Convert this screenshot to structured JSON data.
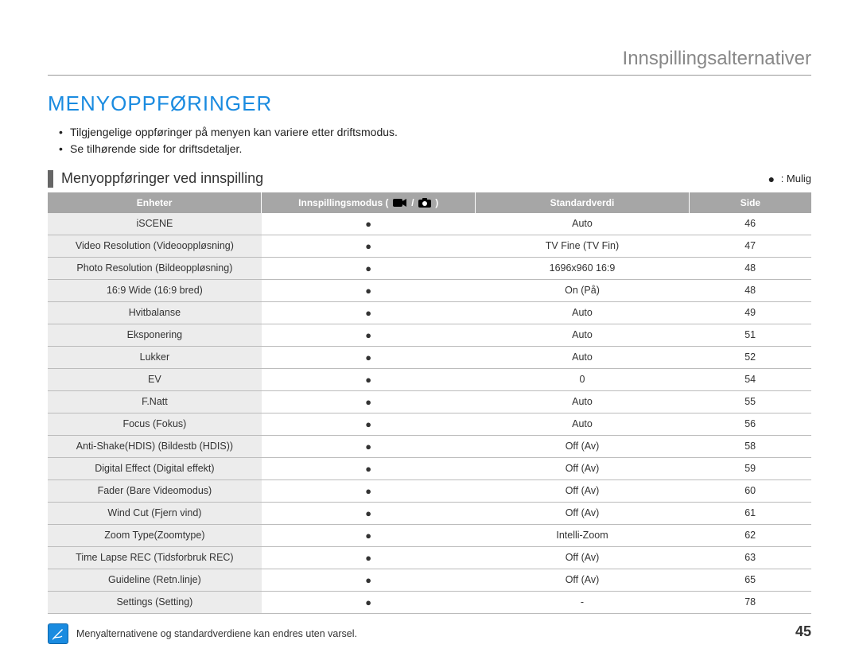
{
  "topTitle": "Innspillingsalternativer",
  "mainHeading": "MENYOPPFØRINGER",
  "bullets": [
    "Tilgjengelige oppføringer på menyen kan variere etter driftsmodus.",
    "Se tilhørende side for driftsdetaljer."
  ],
  "subHeading": "Menyoppføringer ved innspilling",
  "legend": {
    "symbol": "●",
    "label": ": Mulig"
  },
  "table": {
    "headers": {
      "units": "Enheter",
      "modePrefix": "Innspillingsmodus (",
      "modeSep": " / ",
      "modeSuffix": ")",
      "default": "Standardverdi",
      "page": "Side"
    },
    "rows": [
      {
        "name": "iSCENE",
        "mode": "●",
        "default": "Auto",
        "page": "46"
      },
      {
        "name": "Video Resolution (Videooppløsning)",
        "mode": "●",
        "default": "TV Fine (TV Fin)",
        "page": "47"
      },
      {
        "name": "Photo Resolution (Bildeoppløsning)",
        "mode": "●",
        "default": "1696x960 16:9",
        "page": "48"
      },
      {
        "name": "16:9 Wide (16:9 bred)",
        "mode": "●",
        "default": "On (På)",
        "page": "48"
      },
      {
        "name": "Hvitbalanse",
        "mode": "●",
        "default": "Auto",
        "page": "49"
      },
      {
        "name": "Eksponering",
        "mode": "●",
        "default": "Auto",
        "page": "51"
      },
      {
        "name": "Lukker",
        "mode": "●",
        "default": "Auto",
        "page": "52"
      },
      {
        "name": "EV",
        "mode": "●",
        "default": "0",
        "page": "54"
      },
      {
        "name": "F.Natt",
        "mode": "●",
        "default": "Auto",
        "page": "55"
      },
      {
        "name": "Focus (Fokus)",
        "mode": "●",
        "default": "Auto",
        "page": "56"
      },
      {
        "name": "Anti-Shake(HDIS) (Bildestb (HDIS))",
        "mode": "●",
        "default": "Off (Av)",
        "page": "58"
      },
      {
        "name": "Digital Effect (Digital effekt)",
        "mode": "●",
        "default": "Off (Av)",
        "page": "59"
      },
      {
        "name": "Fader (Bare Videomodus)",
        "mode": "●",
        "default": "Off (Av)",
        "page": "60"
      },
      {
        "name": "Wind Cut (Fjern vind)",
        "mode": "●",
        "default": "Off (Av)",
        "page": "61"
      },
      {
        "name": "Zoom Type(Zoomtype)",
        "mode": "●",
        "default": "Intelli-Zoom",
        "page": "62"
      },
      {
        "name": "Time Lapse REC (Tidsforbruk REC)",
        "mode": "●",
        "default": "Off (Av)",
        "page": "63"
      },
      {
        "name": "Guideline (Retn.linje)",
        "mode": "●",
        "default": "Off (Av)",
        "page": "65"
      },
      {
        "name": "Settings (Setting)",
        "mode": "●",
        "default": "-",
        "page": "78"
      }
    ]
  },
  "footerNote": "Menyalternativene og standardverdiene kan endres uten varsel.",
  "pageNumber": "45"
}
